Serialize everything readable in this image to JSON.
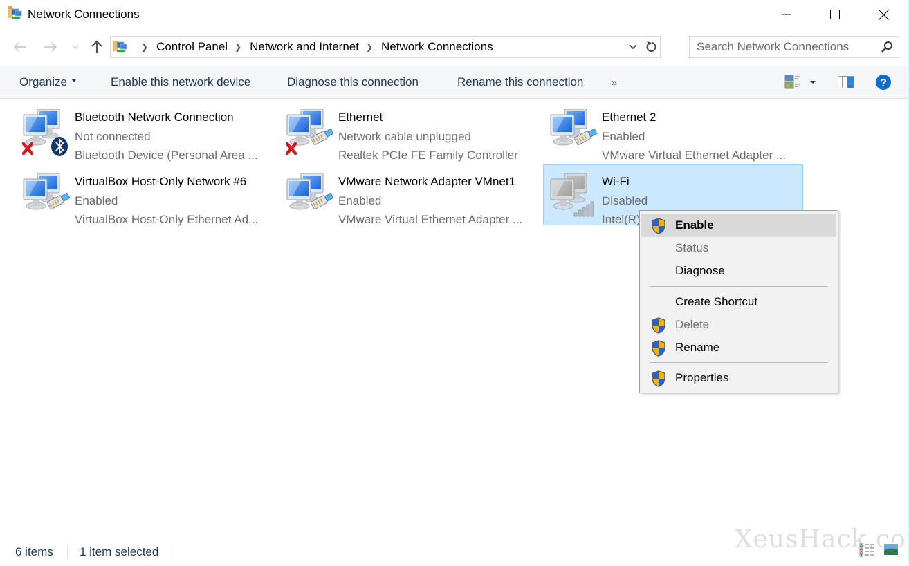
{
  "window": {
    "title": "Network Connections",
    "controls": {
      "minimize": "minimize",
      "maximize": "maximize",
      "close": "close"
    }
  },
  "nav": {
    "breadcrumb": [
      "Control Panel",
      "Network and Internet",
      "Network Connections"
    ],
    "search_placeholder": "Search Network Connections",
    "search_value": ""
  },
  "toolbar": {
    "organize": "Organize",
    "enable": "Enable this network device",
    "diagnose": "Diagnose this connection",
    "rename": "Rename this connection",
    "more": "»"
  },
  "connections": [
    {
      "name": "Bluetooth Network Connection",
      "status": "Not connected",
      "device": "Bluetooth Device (Personal Area ...",
      "icon": "bluetooth-adapter-icon",
      "badge": "error-x",
      "selected": false
    },
    {
      "name": "Ethernet",
      "status": "Network cable unplugged",
      "device": "Realtek PCIe FE Family Controller",
      "icon": "ethernet-adapter-icon",
      "badge": "error-x",
      "selected": false
    },
    {
      "name": "Ethernet 2",
      "status": "Enabled",
      "device": "VMware Virtual Ethernet Adapter ...",
      "icon": "ethernet-adapter-icon",
      "badge": "",
      "selected": false
    },
    {
      "name": "VirtualBox Host-Only Network #6",
      "status": "Enabled",
      "device": "VirtualBox Host-Only Ethernet Ad...",
      "icon": "ethernet-adapter-icon",
      "badge": "",
      "selected": false
    },
    {
      "name": "VMware Network Adapter VMnet1",
      "status": "Enabled",
      "device": "VMware Virtual Ethernet Adapter ...",
      "icon": "ethernet-adapter-icon",
      "badge": "",
      "selected": false
    },
    {
      "name": "Wi-Fi",
      "status": "Disabled",
      "device": "Intel(R)",
      "icon": "wifi-adapter-icon",
      "badge": "",
      "selected": true
    }
  ],
  "context_menu": {
    "items": [
      {
        "label": "Enable",
        "shield": true,
        "bold": true,
        "disabled": false,
        "highlighted": true
      },
      {
        "label": "Status",
        "shield": false,
        "bold": false,
        "disabled": true,
        "highlighted": false
      },
      {
        "label": "Diagnose",
        "shield": false,
        "bold": false,
        "disabled": false,
        "highlighted": false
      },
      {
        "label": "Create Shortcut",
        "shield": false,
        "bold": false,
        "disabled": false,
        "highlighted": false
      },
      {
        "label": "Delete",
        "shield": true,
        "bold": false,
        "disabled": true,
        "highlighted": false
      },
      {
        "label": "Rename",
        "shield": true,
        "bold": false,
        "disabled": false,
        "highlighted": false
      },
      {
        "label": "Properties",
        "shield": true,
        "bold": false,
        "disabled": false,
        "highlighted": false
      }
    ]
  },
  "statusbar": {
    "item_count": "6 items",
    "selection": "1 item selected"
  },
  "watermark": "XeusHack.com",
  "colors": {
    "selection_bg": "#cce8ff",
    "selection_border": "#99d1ff",
    "command_text": "#1e395b",
    "help_blue": "#0c6fd0",
    "error_red": "#d4171e"
  }
}
